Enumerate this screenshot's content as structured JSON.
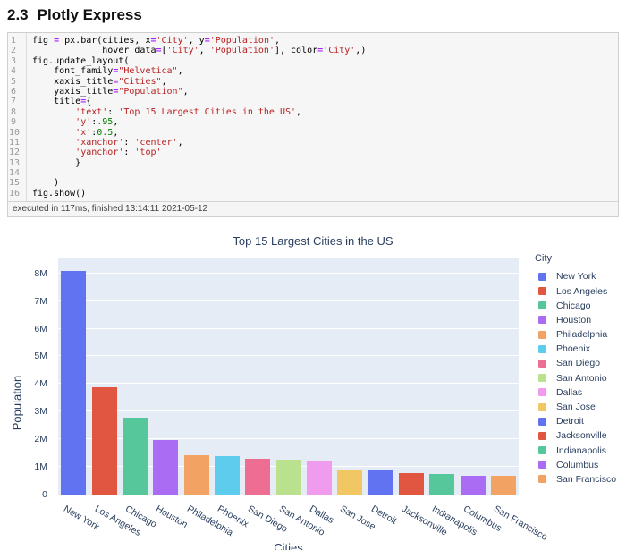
{
  "heading": {
    "number": "2.3",
    "title": "Plotly Express"
  },
  "code_cell": {
    "status": "executed in 117ms, finished 13:14:11 2021-05-12",
    "lines": [
      [
        [
          "p",
          "fig "
        ],
        [
          "o",
          "="
        ],
        [
          "p",
          " px.bar(cities, x"
        ],
        [
          "o",
          "="
        ],
        [
          "s",
          "'City'"
        ],
        [
          "p",
          ", y"
        ],
        [
          "o",
          "="
        ],
        [
          "s",
          "'Population'"
        ],
        [
          "p",
          ","
        ]
      ],
      [
        [
          "p",
          "             hover_data"
        ],
        [
          "o",
          "="
        ],
        [
          "p",
          "["
        ],
        [
          "s",
          "'City'"
        ],
        [
          "p",
          ", "
        ],
        [
          "s",
          "'Population'"
        ],
        [
          "p",
          "], color"
        ],
        [
          "o",
          "="
        ],
        [
          "s",
          "'City'"
        ],
        [
          "p",
          ",)"
        ]
      ],
      [
        [
          "p",
          "fig.update_layout("
        ]
      ],
      [
        [
          "p",
          "    font_family"
        ],
        [
          "o",
          "="
        ],
        [
          "s",
          "\"Helvetica\""
        ],
        [
          "p",
          ","
        ]
      ],
      [
        [
          "p",
          "    xaxis_title"
        ],
        [
          "o",
          "="
        ],
        [
          "s",
          "\"Cities\""
        ],
        [
          "p",
          ","
        ]
      ],
      [
        [
          "p",
          "    yaxis_title"
        ],
        [
          "o",
          "="
        ],
        [
          "s",
          "\"Population\""
        ],
        [
          "p",
          ","
        ]
      ],
      [
        [
          "p",
          "    title"
        ],
        [
          "o",
          "="
        ],
        [
          "p",
          "{"
        ]
      ],
      [
        [
          "p",
          "        "
        ],
        [
          "s",
          "'text'"
        ],
        [
          "p",
          ": "
        ],
        [
          "s",
          "'Top 15 Largest Cities in the US'"
        ],
        [
          "p",
          ","
        ]
      ],
      [
        [
          "p",
          "        "
        ],
        [
          "s",
          "'y'"
        ],
        [
          "p",
          ":"
        ],
        [
          "n",
          ".95"
        ],
        [
          "p",
          ","
        ]
      ],
      [
        [
          "p",
          "        "
        ],
        [
          "s",
          "'x'"
        ],
        [
          "p",
          ":"
        ],
        [
          "n",
          "0.5"
        ],
        [
          "p",
          ","
        ]
      ],
      [
        [
          "p",
          "        "
        ],
        [
          "s",
          "'xanchor'"
        ],
        [
          "p",
          ": "
        ],
        [
          "s",
          "'center'"
        ],
        [
          "p",
          ","
        ]
      ],
      [
        [
          "p",
          "        "
        ],
        [
          "s",
          "'yanchor'"
        ],
        [
          "p",
          ": "
        ],
        [
          "s",
          "'top'"
        ]
      ],
      [
        [
          "p",
          "        }"
        ]
      ],
      [
        [
          "p",
          ""
        ]
      ],
      [
        [
          "p",
          "    )"
        ]
      ],
      [
        [
          "p",
          "fig.show()"
        ]
      ]
    ],
    "syntax_colors": {
      "operator": "#AA22FF",
      "string": "#BA2121",
      "number": "#008000",
      "plain": "#000000"
    }
  },
  "chart_data": {
    "type": "bar",
    "title": "Top 15 Largest Cities in the US",
    "xlabel": "Cities",
    "ylabel": "Population",
    "legend_title": "City",
    "categories": [
      "New York",
      "Los Angeles",
      "Chicago",
      "Houston",
      "Philadelphia",
      "Phoenix",
      "San Diego",
      "San Antonio",
      "Dallas",
      "San Jose",
      "Detroit",
      "Jacksonville",
      "Indianapolis",
      "Columbus",
      "San Francisco"
    ],
    "values": [
      8100000,
      3870000,
      2790000,
      1970000,
      1420000,
      1400000,
      1290000,
      1255000,
      1195000,
      875000,
      870000,
      780000,
      745000,
      700000,
      685000
    ],
    "bar_colors": [
      "#6273F2",
      "#E15640",
      "#55C79B",
      "#AA6CF2",
      "#F2A363",
      "#5ECCEC",
      "#EE6E93",
      "#B9E18E",
      "#F19BEF",
      "#F1C763",
      "#6273F2",
      "#E15640",
      "#55C79B",
      "#AA6CF2",
      "#F2A363"
    ],
    "y_ticks": [
      "0",
      "1M",
      "2M",
      "3M",
      "4M",
      "5M",
      "6M",
      "7M",
      "8M"
    ],
    "ylim": [
      0,
      8560000
    ],
    "grid": true,
    "legend_position": "right",
    "plot_bg": "#E5ECF6",
    "text_color": "#2a3f5f",
    "tick_angle": 30
  }
}
